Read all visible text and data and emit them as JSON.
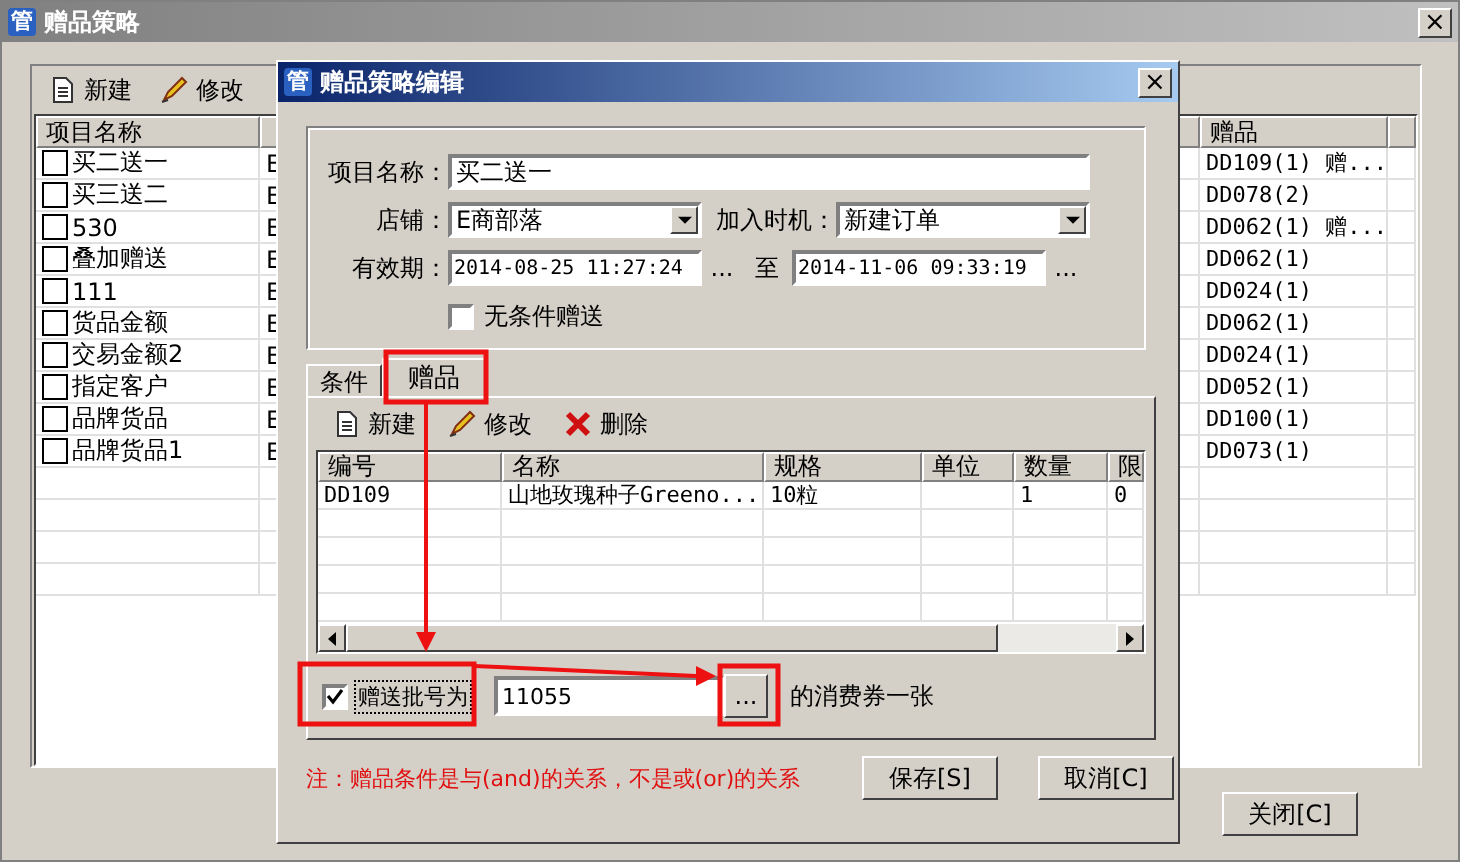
{
  "main_window": {
    "app_icon": "管",
    "title": "赠品策略",
    "close": "×",
    "toolbar": [
      {
        "kind": "new",
        "label": "新建"
      },
      {
        "kind": "edit",
        "label": "修改"
      }
    ],
    "list": {
      "columns": [
        "项目名称",
        "赠品"
      ],
      "rows": [
        {
          "name": "买二送一",
          "checked": false,
          "column_2": "E",
          "gift": "DD109(1) 赠..."
        },
        {
          "name": "买三送二",
          "checked": false,
          "column_2": "E",
          "gift": "DD078(2)"
        },
        {
          "name": "530",
          "checked": false,
          "column_2": "E",
          "gift": "DD062(1) 赠..."
        },
        {
          "name": "叠加赠送",
          "checked": false,
          "column_2": "E",
          "gift": "DD062(1)"
        },
        {
          "name": "111",
          "checked": false,
          "column_2": "E",
          "gift": "DD024(1)"
        },
        {
          "name": "货品金额",
          "checked": false,
          "column_2": "E",
          "gift": "DD062(1)"
        },
        {
          "name": "交易金额2",
          "checked": false,
          "column_2": "E",
          "gift": "DD024(1)"
        },
        {
          "name": "指定客户",
          "checked": false,
          "column_2": "E",
          "gift": "DD052(1)"
        },
        {
          "name": "品牌货品",
          "checked": false,
          "column_2": "E",
          "gift": "DD100(1)"
        },
        {
          "name": "品牌货品1",
          "checked": false,
          "column_2": "E",
          "gift": "DD073(1)"
        }
      ]
    },
    "close_button": "关闭[C]"
  },
  "dialog": {
    "app_icon": "管",
    "title": "赠品策略编辑",
    "close": "×",
    "project_name": {
      "label": "项目名称：",
      "value": "买二送一"
    },
    "store": {
      "label": "店铺：",
      "value": "E商部落"
    },
    "join_time": {
      "label": "加入时机：",
      "value": "新建订单"
    },
    "validity": {
      "label": "有效期：",
      "start": "2014-08-25 11:27:24",
      "start_button": "...",
      "separator": "至",
      "end": "2014-11-06 09:33:19",
      "end_button": "..."
    },
    "unconditional": {
      "label": "无条件赠送",
      "checked": false
    },
    "tabs": [
      {
        "label": "条件",
        "selected": false
      },
      {
        "label": "赠品",
        "selected": true
      }
    ],
    "toolbar": [
      {
        "kind": "new",
        "label": "新建"
      },
      {
        "kind": "edit",
        "label": "修改"
      },
      {
        "kind": "delete",
        "label": "删除"
      }
    ],
    "grid": {
      "columns": [
        "编号",
        "名称",
        "规格",
        "单位",
        "数量",
        "限"
      ],
      "rows": [
        {
          "code": "DD109",
          "name": "山地玫瑰种子Greeno...",
          "spec": "10粒",
          "quantity": "1",
          "limit": "0"
        }
      ]
    },
    "batch": {
      "checked": true,
      "label": "赠送批号为",
      "value": "11055",
      "button": "...",
      "suffix": "的消费券一张"
    },
    "note": "注：赠品条件是与(and)的关系，不是或(or)的关系",
    "buttons": [
      "保存[S]",
      "取消[C]"
    ]
  }
}
